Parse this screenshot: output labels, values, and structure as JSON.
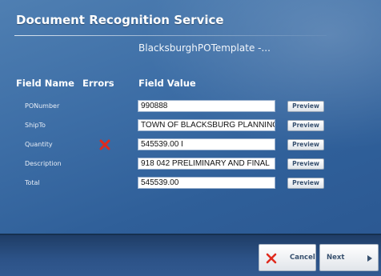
{
  "window": {
    "title": "Document Recognition Service",
    "template_name": "BlacksburghPOTemplate -..."
  },
  "columns": {
    "field_name": "Field Name",
    "errors": "Errors",
    "field_value": "Field Value"
  },
  "fields": [
    {
      "name": "PONumber",
      "value": "990888",
      "has_error": false,
      "action": "Preview"
    },
    {
      "name": "ShipTo",
      "value": "TOWN OF BLACKSBURG PLANNING",
      "has_error": false,
      "action": "Preview"
    },
    {
      "name": "Quantity",
      "value": "545539.00 I",
      "has_error": true,
      "action": "Preview"
    },
    {
      "name": "Description",
      "value": "918 042 PRELIMINARY AND FINAL",
      "has_error": false,
      "action": "Preview"
    },
    {
      "name": "Total",
      "value": "545539.00",
      "has_error": false,
      "action": "Preview"
    }
  ],
  "footer": {
    "cancel_label": "Cancel",
    "next_label": "Next"
  },
  "icons": {
    "error": "x-error-icon",
    "cancel": "x-icon",
    "next": "arrow-right-icon"
  },
  "colors": {
    "background": "#3d6ea6",
    "error_red": "#e02b1e",
    "button_text": "#38516f"
  }
}
